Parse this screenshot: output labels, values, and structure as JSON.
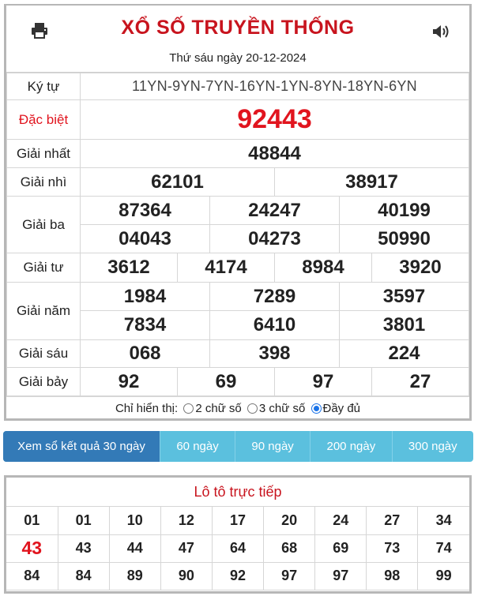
{
  "header": {
    "title": "XỔ SỐ TRUYỀN THỐNG",
    "date": "Thứ sáu ngày 20-12-2024",
    "print_icon": "printer-icon",
    "sound_icon": "speaker-icon"
  },
  "results": {
    "kytu_label": "Ký tự",
    "kytu_value": "11YN-9YN-7YN-16YN-1YN-8YN-18YN-6YN",
    "db_label": "Đặc biệt",
    "db_value": "92443",
    "g1_label": "Giải nhất",
    "g1": [
      "48844"
    ],
    "g2_label": "Giải nhì",
    "g2": [
      "62101",
      "38917"
    ],
    "g3_label": "Giải ba",
    "g3": [
      "87364",
      "24247",
      "40199",
      "04043",
      "04273",
      "50990"
    ],
    "g4_label": "Giải tư",
    "g4": [
      "3612",
      "4174",
      "8984",
      "3920"
    ],
    "g5_label": "Giải năm",
    "g5": [
      "1984",
      "7289",
      "3597",
      "7834",
      "6410",
      "3801"
    ],
    "g6_label": "Giải sáu",
    "g6": [
      "068",
      "398",
      "224"
    ],
    "g7_label": "Giải bảy",
    "g7": [
      "92",
      "69",
      "97",
      "27"
    ]
  },
  "options": {
    "label": "Chỉ hiển thị:",
    "items": [
      "2 chữ số",
      "3 chữ số",
      "Đầy đủ"
    ],
    "selected": "Đầy đủ"
  },
  "tabs": [
    {
      "label": "Xem sổ kết quả 30 ngày",
      "active": true
    },
    {
      "label": "60 ngày",
      "active": false
    },
    {
      "label": "90 ngày",
      "active": false
    },
    {
      "label": "200 ngày",
      "active": false
    },
    {
      "label": "300 ngày",
      "active": false
    }
  ],
  "loto": {
    "title": "Lô tô trực tiếp",
    "rows": [
      [
        "01",
        "01",
        "10",
        "12",
        "17",
        "20",
        "24",
        "27",
        "34"
      ],
      [
        "43",
        "43",
        "44",
        "47",
        "64",
        "68",
        "69",
        "73",
        "74"
      ],
      [
        "84",
        "84",
        "89",
        "90",
        "92",
        "97",
        "97",
        "98",
        "99"
      ]
    ],
    "highlight": "43",
    "highlight_color": "#e1141e"
  },
  "colors": {
    "title_red": "#c8141e",
    "tab_active": "#337ab7",
    "tab_inactive": "#5bc0de"
  }
}
